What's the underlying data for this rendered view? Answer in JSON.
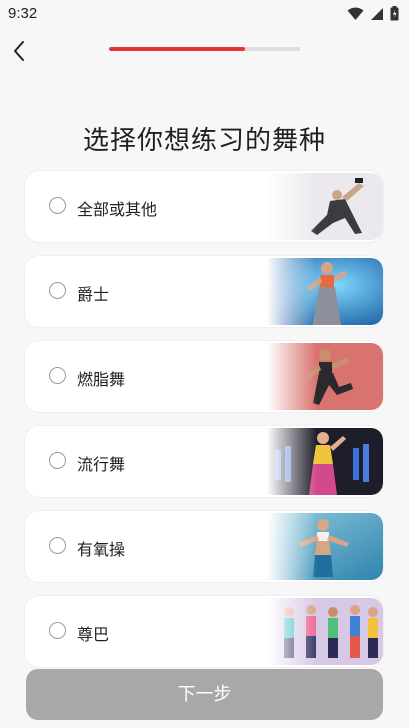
{
  "status": {
    "time": "9:32"
  },
  "progress": {
    "fraction": 0.71
  },
  "title": "选择你想练习的舞种",
  "options": [
    {
      "label": "全部或其他",
      "icon": "dancer-white-icon",
      "color": "#ece9ee"
    },
    {
      "label": "爵士",
      "icon": "dancer-blue-icon",
      "color": "#2e9bd6"
    },
    {
      "label": "燃脂舞",
      "icon": "dancer-red-icon",
      "color": "#d9736f"
    },
    {
      "label": "流行舞",
      "icon": "dancer-black-icon",
      "color": "#1e1e2a"
    },
    {
      "label": "有氧操",
      "icon": "dancer-teal-icon",
      "color": "#3fa0c4"
    },
    {
      "label": "尊巴",
      "icon": "dancer-group-icon",
      "color": "#d7c9e6"
    }
  ],
  "next_button": {
    "label": "下一步",
    "color": "#a8a8a8"
  },
  "colors": {
    "accent": "#e8333b",
    "track": "#e2dde2"
  }
}
